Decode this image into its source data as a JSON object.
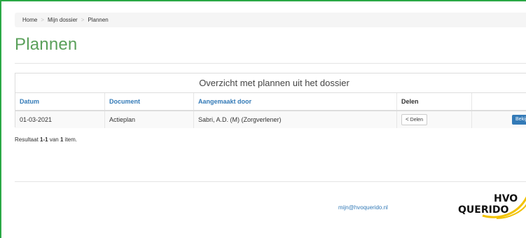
{
  "breadcrumb": {
    "home": "Home",
    "my_file": "Mijn dossier",
    "current": "Plannen",
    "separator": ">"
  },
  "page": {
    "title": "Plannen"
  },
  "panel": {
    "heading": "Overzicht met plannen uit het dossier",
    "columns": {
      "date": "Datum",
      "document": "Document",
      "created_by": "Aangemaakt door",
      "share": "Delen"
    },
    "rows": [
      {
        "date": "01-03-2021",
        "document": "Actieplan",
        "created_by": "Sabri, A.D. (M) (Zorgverlener)",
        "share_label": "Delen",
        "view_label": "Bekijk"
      }
    ]
  },
  "pagination": {
    "prefix": "Resultaat ",
    "range": "1-1",
    "middle": " van ",
    "total": "1",
    "suffix": " item."
  },
  "footer": {
    "email": "mijn@hvoquerido.nl",
    "logo_line1": "HVO",
    "logo_line2": "QUERIDO"
  },
  "colors": {
    "accent_green": "#2aa845",
    "title_green": "#5aa05a",
    "link_blue": "#337ab7",
    "logo_yellow": "#f2c200"
  },
  "icons": {
    "share": "share-icon"
  }
}
